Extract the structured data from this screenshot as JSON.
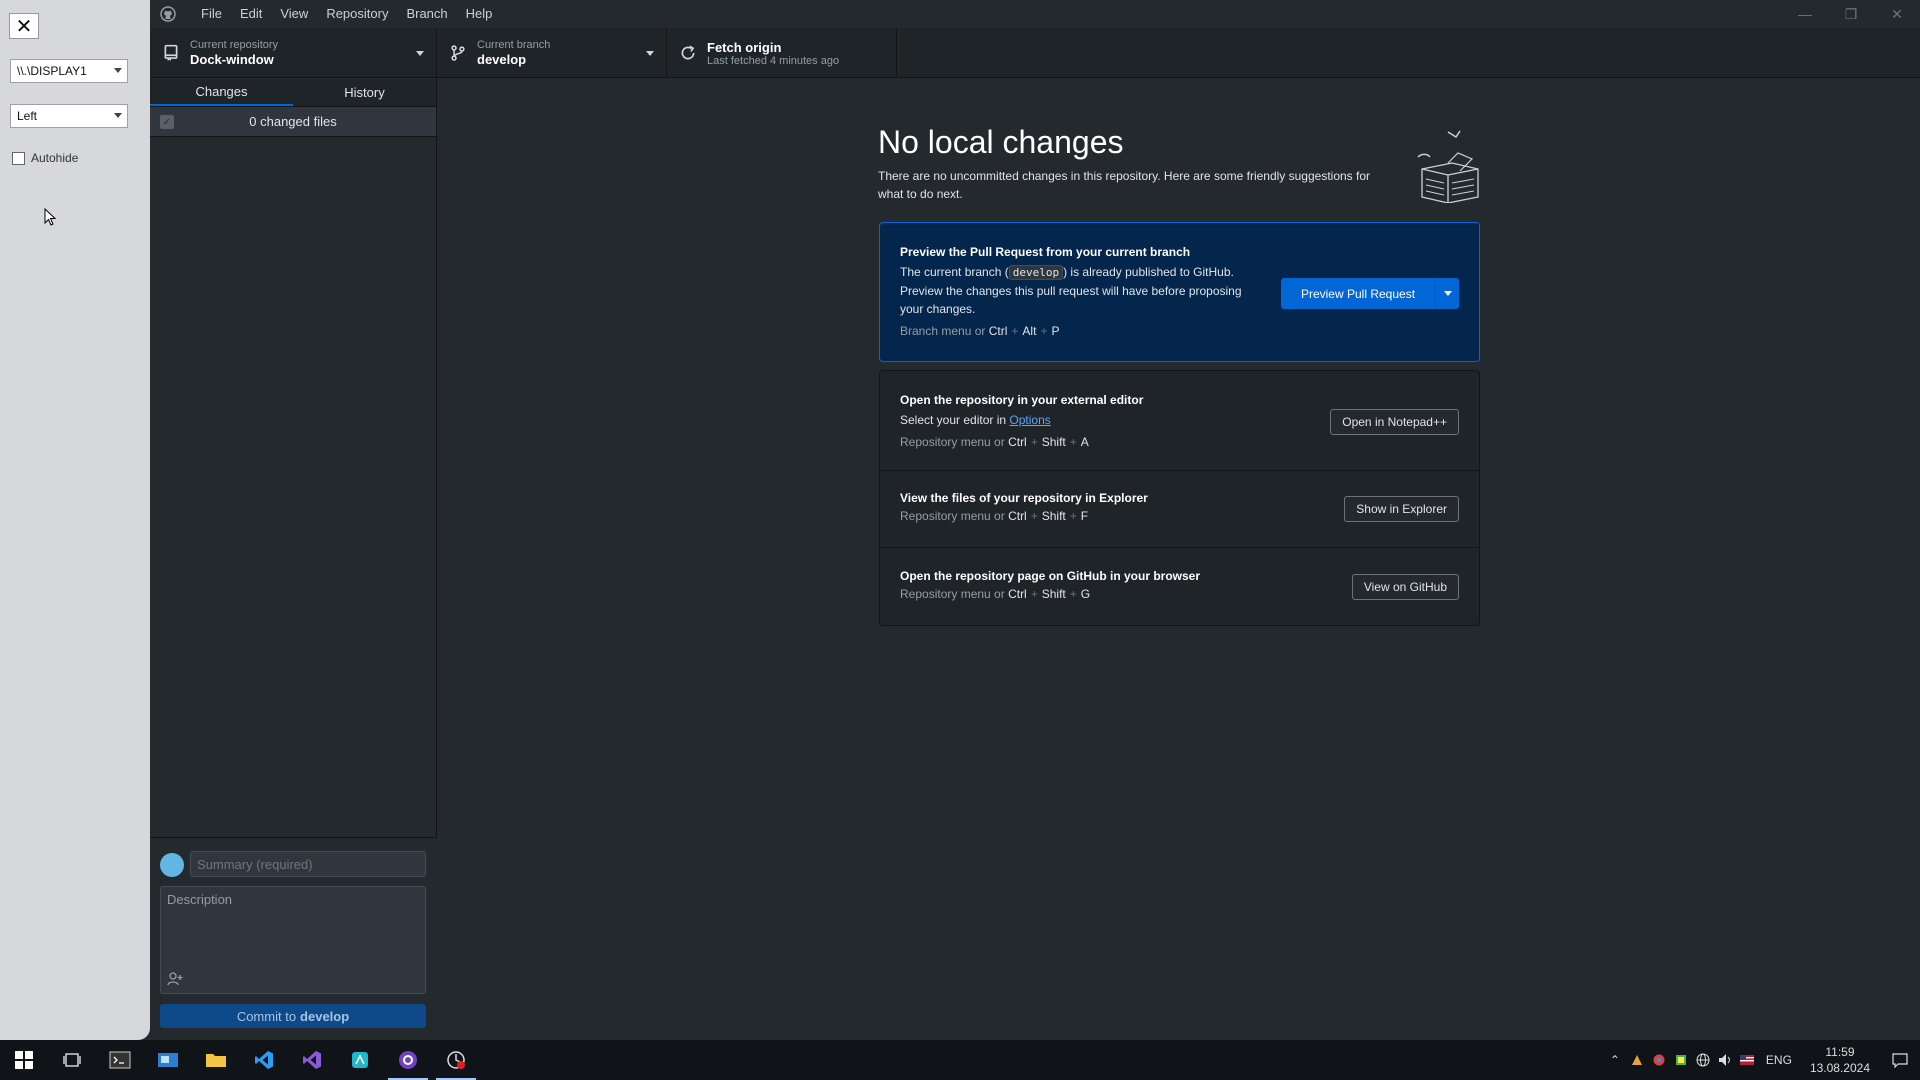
{
  "dock": {
    "close_symbol": "✕",
    "display_select": "\\\\.\\DISPLAY1",
    "side_select": "Left",
    "autohide_label": "Autohide"
  },
  "menu": [
    "File",
    "Edit",
    "View",
    "Repository",
    "Branch",
    "Help"
  ],
  "toolbar": {
    "repo_label": "Current repository",
    "repo_value": "Dock-window",
    "branch_label": "Current branch",
    "branch_value": "develop",
    "fetch_title": "Fetch origin",
    "fetch_sub": "Last fetched 4 minutes ago"
  },
  "sidebar": {
    "tabs": [
      "Changes",
      "History"
    ],
    "changed_files": "0 changed files",
    "summary_placeholder": "Summary (required)",
    "description_placeholder": "Description",
    "commit_prefix": "Commit to",
    "commit_branch": "develop"
  },
  "main": {
    "title": "No local changes",
    "description": "There are no uncommitted changes in this repository. Here are some friendly suggestions for what to do next.",
    "pr_card": {
      "title": "Preview the Pull Request from your current branch",
      "line1_pre": "The current branch (",
      "line1_code": "develop",
      "line1_post": ") is already published to GitHub.",
      "line2": "Preview the changes this pull request will have before proposing your changes.",
      "shortcut_prefix": "Branch menu or",
      "shortcut_keys": [
        "Ctrl",
        "Alt",
        "P"
      ],
      "button": "Preview Pull Request"
    },
    "editor_card": {
      "title": "Open the repository in your external editor",
      "text_pre": "Select your editor in",
      "text_link": "Options",
      "shortcut_prefix": "Repository menu or",
      "shortcut_keys": [
        "Ctrl",
        "Shift",
        "A"
      ],
      "button": "Open in Notepad++"
    },
    "explorer_card": {
      "title": "View the files of your repository in Explorer",
      "shortcut_prefix": "Repository menu or",
      "shortcut_keys": [
        "Ctrl",
        "Shift",
        "F"
      ],
      "button": "Show in Explorer"
    },
    "github_card": {
      "title": "Open the repository page on GitHub in your browser",
      "shortcut_prefix": "Repository menu or",
      "shortcut_keys": [
        "Ctrl",
        "Shift",
        "G"
      ],
      "button": "View on GitHub"
    }
  },
  "taskbar": {
    "lang": "ENG",
    "time": "11:59",
    "date": "13.08.2024"
  },
  "colors": {
    "accent": "#0366d6",
    "background": "#24292e",
    "dock_bg": "#d7d8dc"
  }
}
